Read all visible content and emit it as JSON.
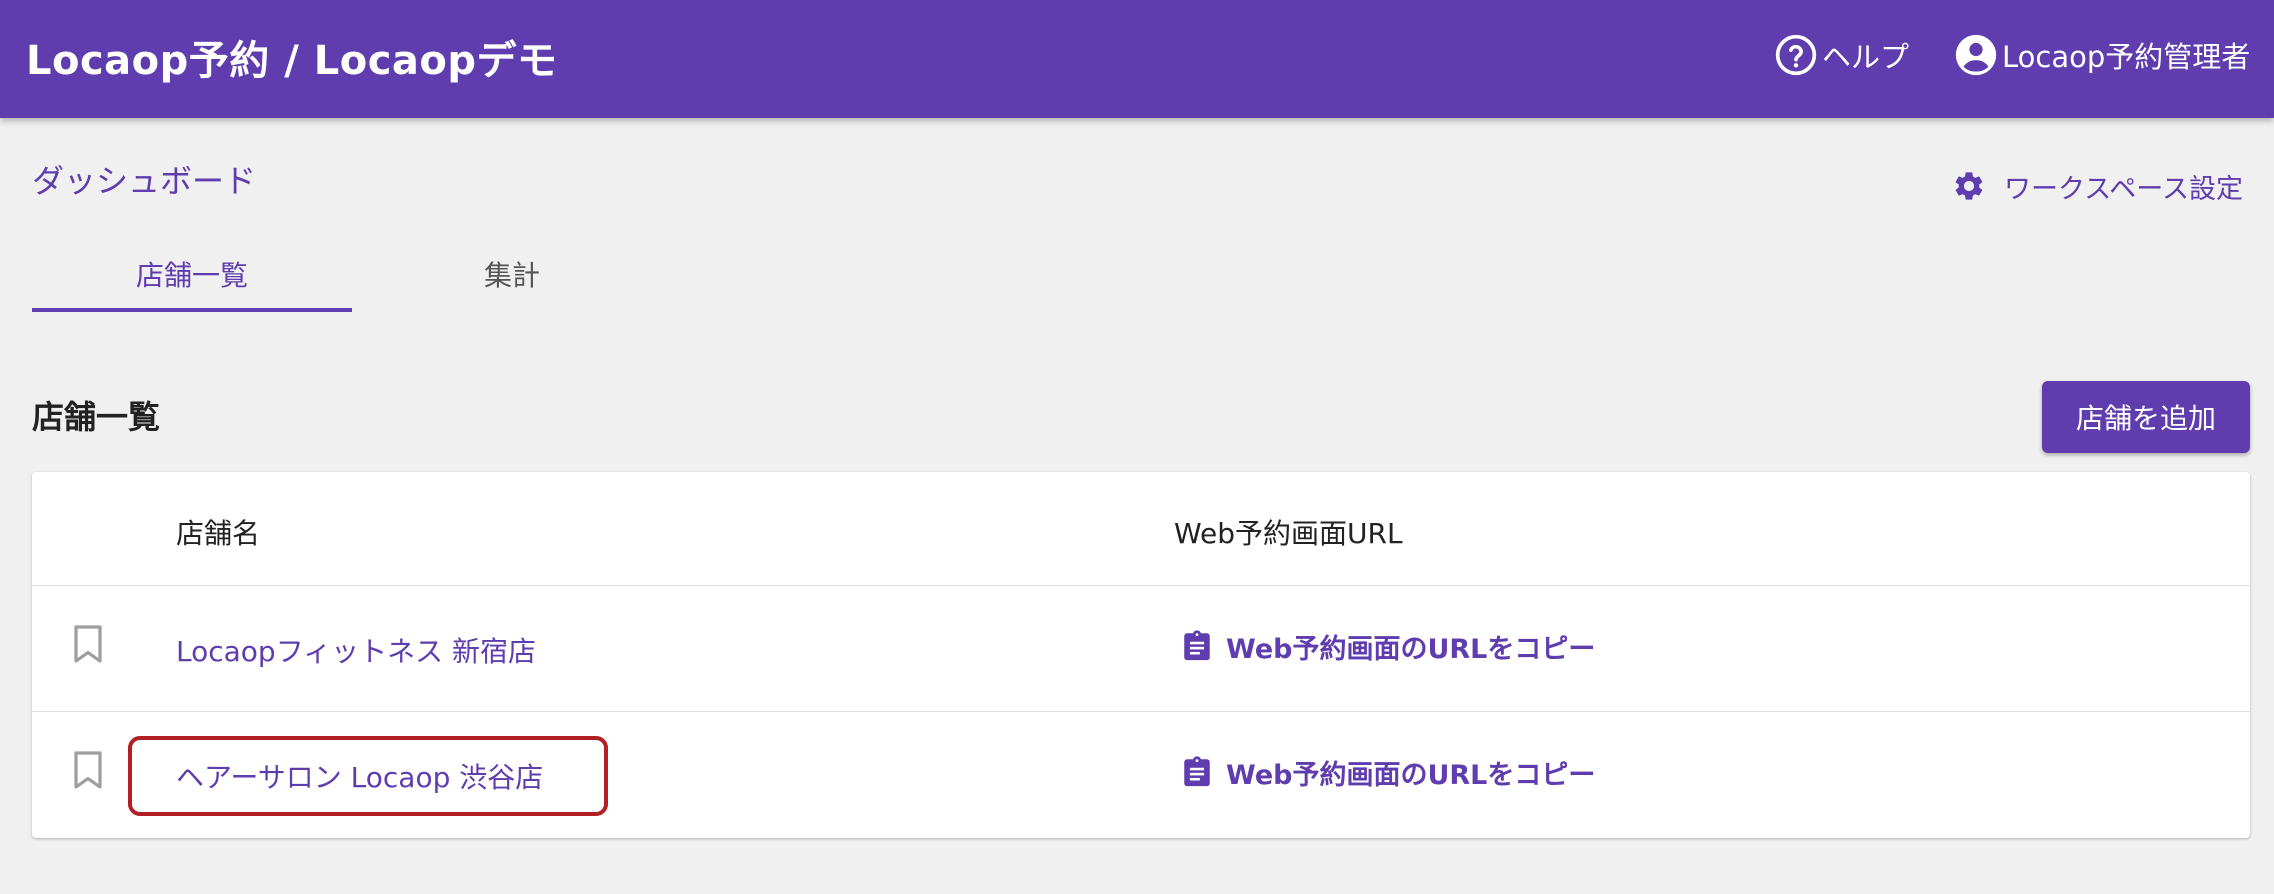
{
  "header": {
    "title": "Locaop予約 / Locaopデモ",
    "help_label": "ヘルプ",
    "user_label": "Locaop予約管理者"
  },
  "page": {
    "heading": "ダッシュボード",
    "workspace_settings_label": "ワークスペース設定"
  },
  "tabs": [
    {
      "label": "店舗一覧",
      "active": true
    },
    {
      "label": "集計",
      "active": false
    }
  ],
  "section": {
    "title": "店舗一覧",
    "add_button_label": "店舗を追加"
  },
  "table": {
    "columns": [
      "店舗名",
      "Web予約画面URL"
    ],
    "rows": [
      {
        "name": "Locaopフィットネス 新宿店",
        "url_action": "Web予約画面のURLをコピー"
      },
      {
        "name": "ヘアーサロン Locaop 渋谷店",
        "url_action": "Web予約画面のURLをコピー",
        "highlighted": true
      }
    ]
  },
  "colors": {
    "primary": "#5f3dae",
    "highlight_border": "#b21f24",
    "background": "#f0f0f0"
  },
  "icons": {
    "help": "help-circle-icon",
    "user": "account-circle-icon",
    "settings": "gear-icon",
    "bookmark": "bookmark-outline-icon",
    "copy": "clipboard-icon"
  }
}
